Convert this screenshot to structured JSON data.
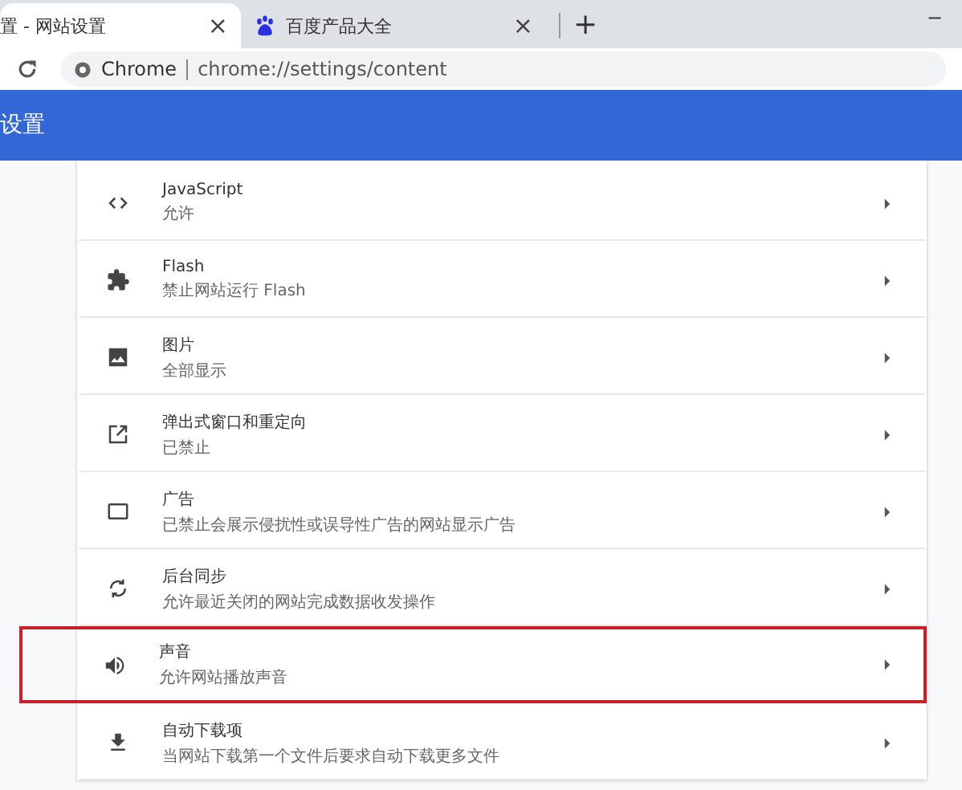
{
  "tabs": [
    {
      "title": "置 - 网站设置",
      "kind": "page",
      "close": "×",
      "selected": true
    },
    {
      "title": "百度产品大全",
      "kind": "baidu",
      "close": "×",
      "selected": false
    }
  ],
  "new_tab": "+",
  "minimize": "−",
  "address_bar": {
    "site": "Chrome",
    "url": "chrome://settings/content"
  },
  "header": {
    "title": "设置"
  },
  "settings": [
    {
      "kind": "code",
      "title": "JavaScript",
      "subtitle": "允许",
      "highlighted": false
    },
    {
      "kind": "puzzle",
      "title": "Flash",
      "subtitle": "禁止网站运行 Flash",
      "highlighted": false
    },
    {
      "kind": "image",
      "title": "图片",
      "subtitle": "全部显示",
      "highlighted": false
    },
    {
      "kind": "popup",
      "title": "弹出式窗口和重定向",
      "subtitle": "已禁止",
      "highlighted": false
    },
    {
      "kind": "ad",
      "title": "广告",
      "subtitle": "已禁止会展示侵扰性或误导性广告的网站显示广告",
      "highlighted": false
    },
    {
      "kind": "sync",
      "title": "后台同步",
      "subtitle": "允许最近关闭的网站完成数据收发操作",
      "highlighted": false
    },
    {
      "kind": "sound",
      "title": "声音",
      "subtitle": "允许网站播放声音",
      "highlighted": true
    },
    {
      "kind": "download",
      "title": "自动下载项",
      "subtitle": "当网站下载第一个文件后要求自动下载更多文件",
      "highlighted": false
    }
  ]
}
